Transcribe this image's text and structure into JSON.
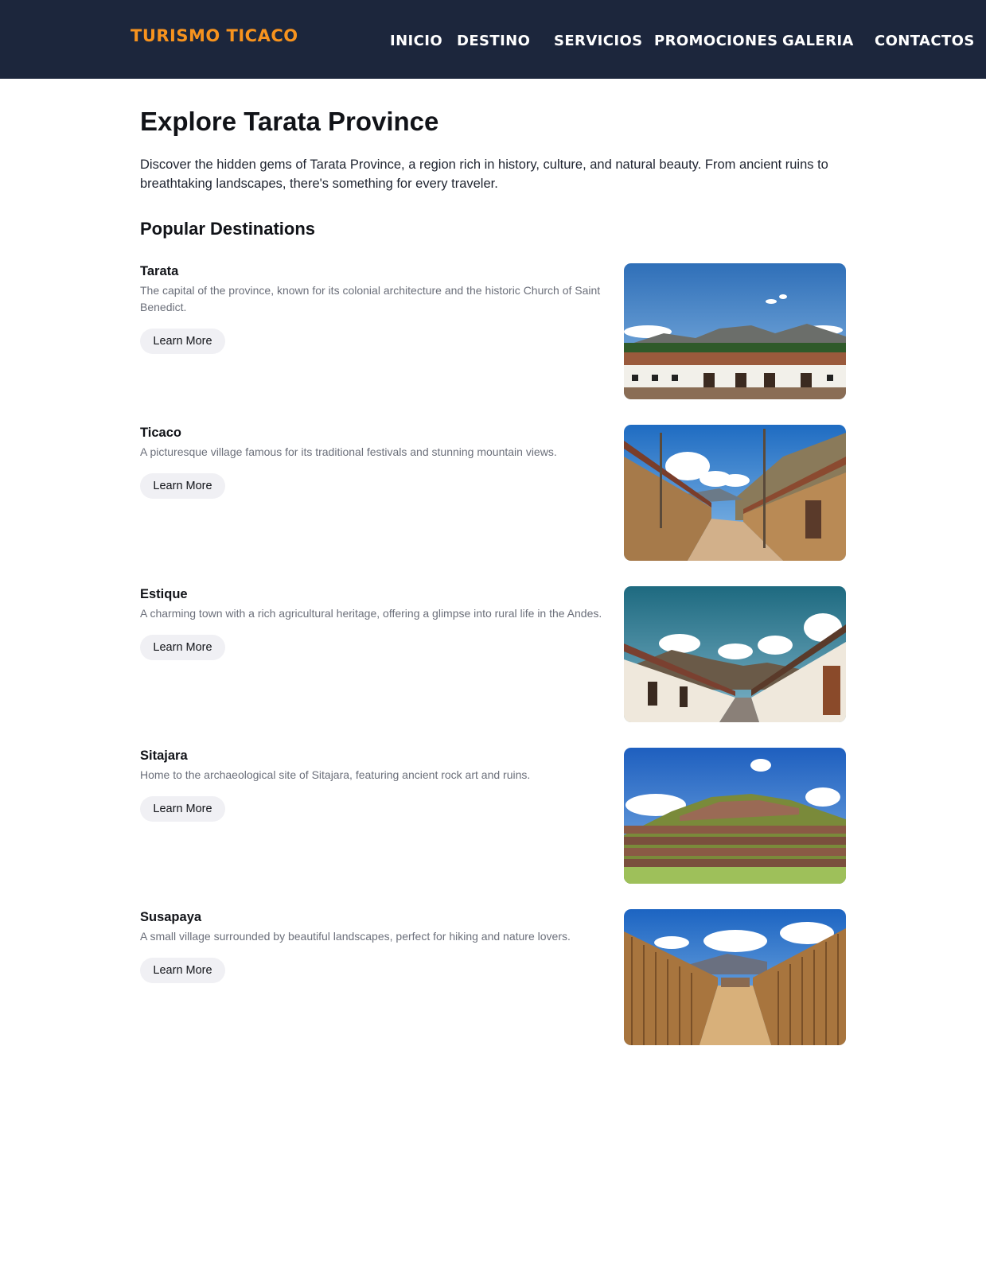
{
  "header": {
    "brand": "TURISMO TICACO",
    "nav": [
      "INICIO",
      "DESTINO",
      "SERVICIOS",
      "PROMOCIONES",
      "GALERIA",
      "CONTACTOS"
    ]
  },
  "main": {
    "title": "Explore Tarata Province",
    "intro": "Discover the hidden gems of Tarata Province, a region rich in history, culture, and natural beauty. From ancient ruins to breathtaking landscapes, there's something for every traveler.",
    "section_title": "Popular Destinations",
    "destinations": [
      {
        "name": "Tarata",
        "description": "The capital of the province, known for its colonial architecture and the historic Church of Saint Benedict.",
        "button": "Learn More"
      },
      {
        "name": "Ticaco",
        "description": "A picturesque village famous for its traditional festivals and stunning mountain views.",
        "button": "Learn More"
      },
      {
        "name": "Estique",
        "description": "A charming town with a rich agricultural heritage, offering a glimpse into rural life in the Andes.",
        "button": "Learn More"
      },
      {
        "name": "Sitajara",
        "description": "Home to the archaeological site of Sitajara, featuring ancient rock art and ruins.",
        "button": "Learn More"
      },
      {
        "name": "Susapaya",
        "description": "A small village surrounded by beautiful landscapes, perfect for hiking and nature lovers.",
        "button": "Learn More"
      }
    ]
  },
  "colors": {
    "header_bg": "#1c263c",
    "brand": "#f7931e",
    "button_bg": "#f0f0f4",
    "muted_text": "#6b6f7a"
  }
}
